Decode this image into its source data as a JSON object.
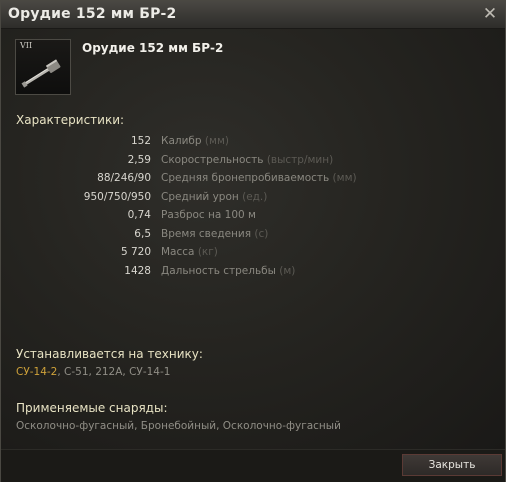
{
  "window": {
    "title": "Орудие 152 мм БР-2"
  },
  "module": {
    "tier": "VII",
    "name": "Орудие 152 мм БР-2",
    "icon": "gun-icon"
  },
  "characteristics": {
    "heading": "Характеристики:",
    "rows": [
      {
        "value": "152",
        "label": "Калибр",
        "unit": "(мм)"
      },
      {
        "value": "2,59",
        "label": "Скорострельность",
        "unit": "(выстр/мин)"
      },
      {
        "value": "88/246/90",
        "label": "Средняя бронепробиваемость",
        "unit": "(мм)"
      },
      {
        "value": "950/750/950",
        "label": "Средний урон",
        "unit": "(ед.)"
      },
      {
        "value": "0,74",
        "label": "Разброс на 100 м",
        "unit": ""
      },
      {
        "value": "6,5",
        "label": "Время сведения",
        "unit": "(с)"
      },
      {
        "value": "5 720",
        "label": "Масса",
        "unit": "(кг)"
      },
      {
        "value": "1428",
        "label": "Дальность стрельбы",
        "unit": "(м)"
      }
    ]
  },
  "vehicles": {
    "heading": "Устанавливается на технику:",
    "current": "СУ-14-2",
    "others": ", С-51, 212А, СУ-14-1"
  },
  "shells": {
    "heading": "Применяемые снаряды:",
    "list": "Осколочно-фугасный, Бронебойный, Осколочно-фугасный"
  },
  "footer": {
    "close_label": "Закрыть"
  },
  "colors": {
    "accent_gold": "#cfa23a",
    "heading": "#e8e3c4",
    "close_button_border": "#5b3a35"
  }
}
